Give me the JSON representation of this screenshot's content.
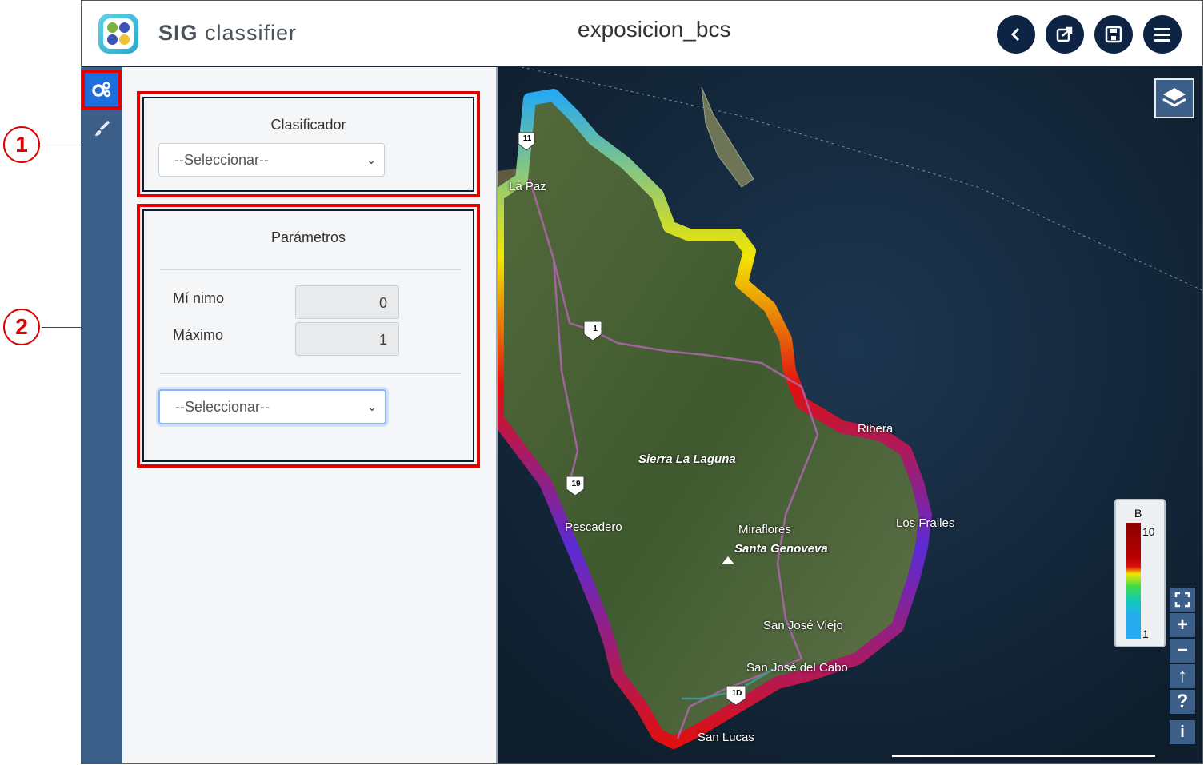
{
  "app": {
    "brand_bold": "SIG",
    "brand_light": "classifier",
    "title": "exposicion_bcs",
    "toolbar": {
      "back_icon": "chevron-left-icon",
      "export_icon": "share-export-icon",
      "save_icon": "save-disk-icon",
      "menu_icon": "hamburger-menu-icon"
    }
  },
  "rail": {
    "items": [
      {
        "icon": "gears-icon",
        "active": true
      },
      {
        "icon": "paintbrush-icon",
        "active": false
      }
    ]
  },
  "panel": {
    "classifier": {
      "heading": "Clasificador",
      "select_value": "--Seleccionar--"
    },
    "parameters": {
      "heading": "Parámetros",
      "min_label": "Mí nimo",
      "min_value": "0",
      "max_label": "Máximo",
      "max_value": "1",
      "select_value": "--Seleccionar--"
    }
  },
  "annotations": {
    "marker1": "1",
    "marker2": "2"
  },
  "map": {
    "places": {
      "la_paz": "La Paz",
      "sierra": "Sierra La Laguna",
      "pescadero": "Pescadero",
      "miraflores": "Miraflores",
      "santa_genoveva": "Santa Genoveva",
      "los_frailes": "Los Frailes",
      "ribera": "Ribera",
      "san_jose_viejo": "San José Viejo",
      "san_jose_del_cabo": "San José del Cabo",
      "cabo_san_lucas": "San Lucas"
    },
    "shields": {
      "hwy_1": "1",
      "hwy_19": "19",
      "hwy_1d": "1D",
      "hwy_11": "11"
    },
    "legend": {
      "title": "B",
      "max": "10",
      "min": "1",
      "colors": [
        "#8b0000",
        "#e01010",
        "#f2e600",
        "#3ddc4a",
        "#10c8c0",
        "#27aaf0"
      ]
    },
    "controls": {
      "fullscreen_icon": "fullscreen-icon",
      "zoom_in": "+",
      "zoom_out": "−",
      "north": "↑",
      "help": "?",
      "info": "i"
    }
  }
}
